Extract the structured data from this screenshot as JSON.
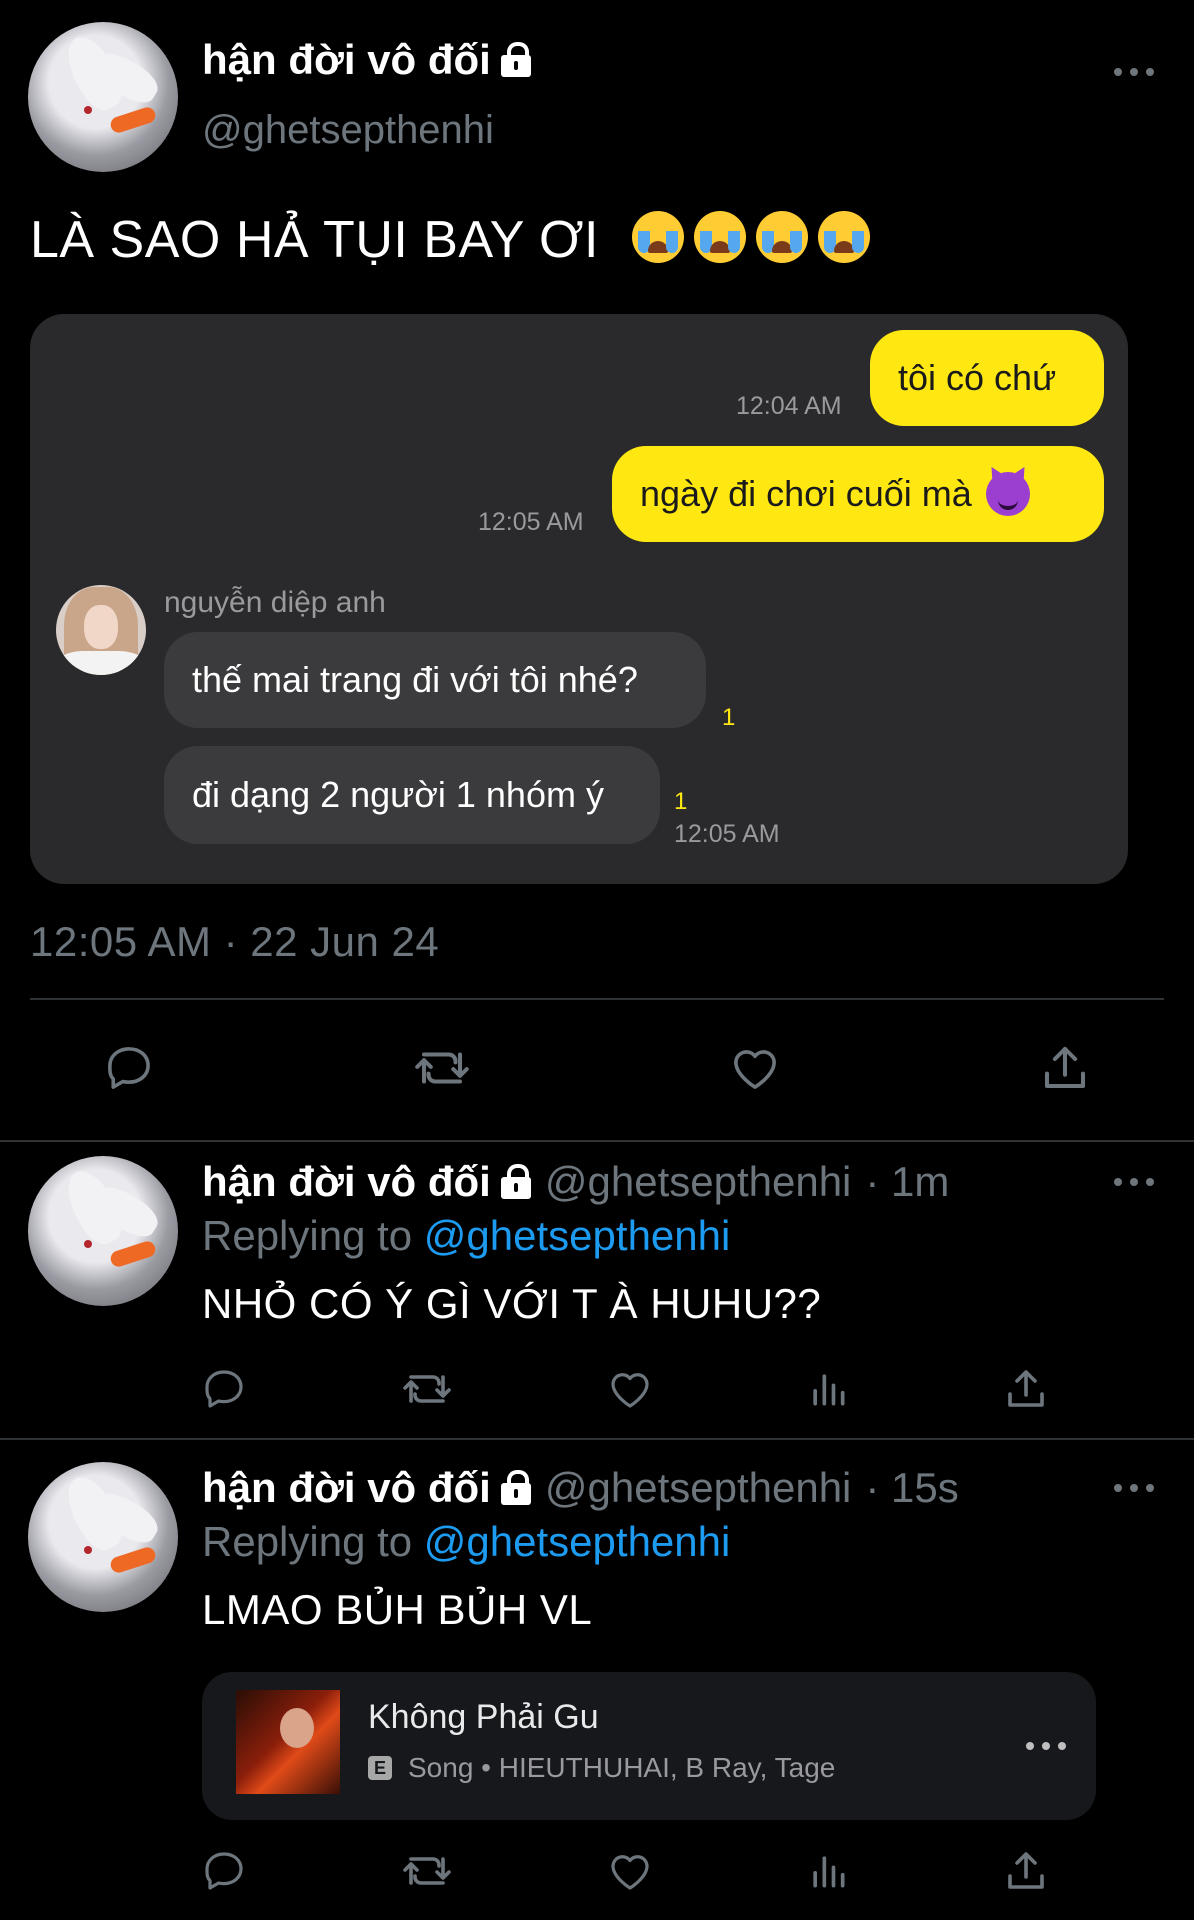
{
  "tweet": {
    "display_name": "hận đời vô đối",
    "handle": "@ghetsepthenhi",
    "text": "LÀ SAO HẢ TỤI BAY ƠI",
    "emoji_count": 4,
    "datetime": "12:05 AM · 22 Jun 24"
  },
  "chat": {
    "messages_me": [
      {
        "text": "tôi có chứ",
        "time": "12:04 AM"
      },
      {
        "text": "ngày đi chơi cuối mà",
        "time": "12:05 AM"
      }
    ],
    "sender_name": "nguyễn diệp anh",
    "messages_other": [
      {
        "text": "thế mai trang đi với tôi nhé?",
        "unread": "1"
      },
      {
        "text": "đi dạng 2 người 1 nhóm ý",
        "unread": "1",
        "time": "12:05 AM"
      }
    ]
  },
  "replies": [
    {
      "display_name": "hận đời vô đối",
      "handle": "@ghetsepthenhi",
      "age": "· 1m",
      "replying_label": "Replying to",
      "replying_to": "@ghetsepthenhi",
      "text": "NHỎ CÓ Ý GÌ VỚI T À HUHU??"
    },
    {
      "display_name": "hận đời vô đối",
      "handle": "@ghetsepthenhi",
      "age": "· 15s",
      "replying_label": "Replying to",
      "replying_to": "@ghetsepthenhi",
      "text": "LMAO BỦH BỦH VL",
      "music": {
        "title": "Không Phải Gu",
        "badge": "E",
        "subtitle": "Song • HIEUTHUHAI, B Ray, Tage"
      }
    }
  ],
  "colors": {
    "accent": "#1d9bf0",
    "chat_bubble_me": "#ffe812",
    "muted": "#6e767d"
  }
}
